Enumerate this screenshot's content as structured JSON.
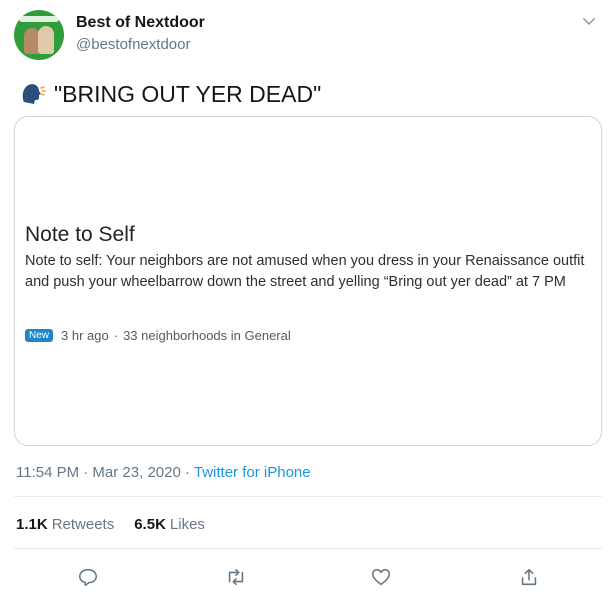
{
  "tweet": {
    "author_name": "Best of Nextdoor",
    "author_handle": "@bestofnextdoor",
    "text": "\"BRING OUT YER DEAD\"",
    "timestamp": "11:54 PM · Mar 23, 2020 · ",
    "source": "Twitter for iPhone"
  },
  "card": {
    "title": "Note to Self",
    "body": "Note to self:  Your neighbors are not amused when you dress in your Renaissance outfit and push your wheelbarrow down the street and yelling “Bring out yer dead” at 7 PM",
    "badge": "New",
    "time_ago": "3 hr ago",
    "separator": "·",
    "neighborhoods": "33 neighborhoods in General"
  },
  "stats": {
    "retweets_count": "1.1K",
    "retweets_label": "Retweets",
    "likes_count": "6.5K",
    "likes_label": "Likes"
  },
  "icons": {
    "emoji": "speaking-head-icon",
    "menu": "chevron-down-icon",
    "reply": "reply-icon",
    "retweet": "retweet-icon",
    "like": "heart-icon",
    "share": "share-icon"
  },
  "colors": {
    "accent": "#1b95e0",
    "muted": "#657786",
    "badge": "#1e88c7",
    "avatar_bg": "#2f9e3a"
  }
}
